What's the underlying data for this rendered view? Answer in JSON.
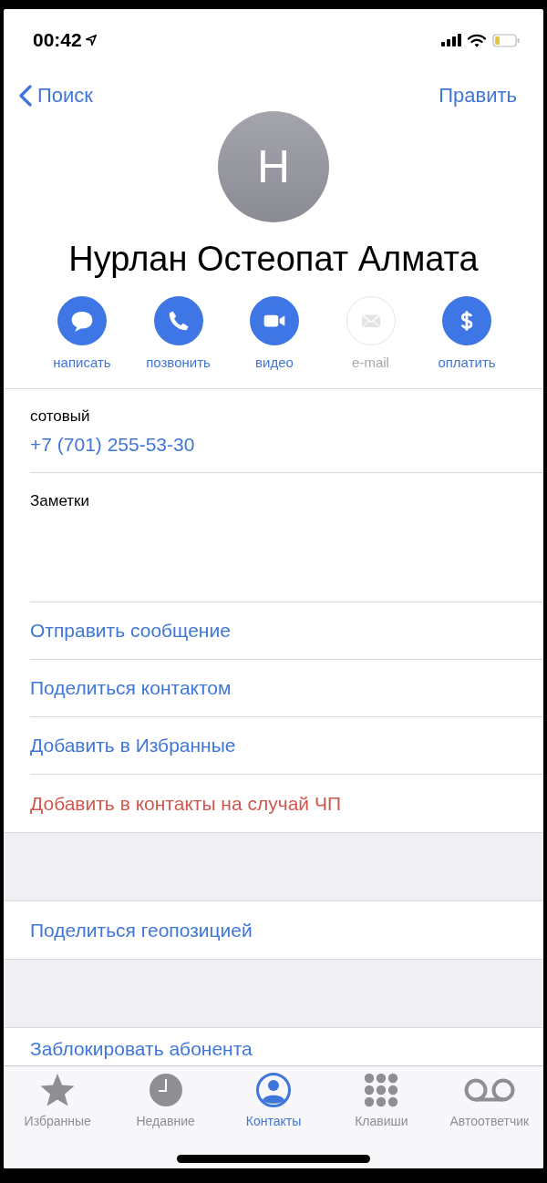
{
  "status_bar": {
    "time": "00:42"
  },
  "nav": {
    "back": "Поиск",
    "edit": "Править"
  },
  "contact": {
    "initial": "Н",
    "name": "Нурлан Остеопат Алмата"
  },
  "actions": [
    {
      "kind": "message",
      "label": "написать",
      "disabled": false
    },
    {
      "kind": "call",
      "label": "позвонить",
      "disabled": false
    },
    {
      "kind": "video",
      "label": "видео",
      "disabled": false
    },
    {
      "kind": "mail",
      "label": "e-mail",
      "disabled": true
    },
    {
      "kind": "pay",
      "label": "оплатить",
      "disabled": false
    }
  ],
  "phone": {
    "label": "сотовый",
    "number": "+7 (701) 255-53-30"
  },
  "notes": {
    "label": "Заметки"
  },
  "sections": [
    [
      {
        "label": "Отправить сообщение",
        "destructive": false
      },
      {
        "label": "Поделиться контактом",
        "destructive": false
      },
      {
        "label": "Добавить в Избранные",
        "destructive": false
      },
      {
        "label": "Добавить в контакты на случай ЧП",
        "destructive": true
      }
    ],
    [
      {
        "label": "Поделиться геопозицией",
        "destructive": false
      }
    ],
    [
      {
        "label": "Заблокировать абонента",
        "destructive": false
      }
    ]
  ],
  "tab_bar": [
    {
      "kind": "star",
      "label": "Избранные",
      "selected": false
    },
    {
      "kind": "clock",
      "label": "Недавние",
      "selected": false
    },
    {
      "kind": "person",
      "label": "Контакты",
      "selected": true
    },
    {
      "kind": "keypad",
      "label": "Клавиши",
      "selected": false
    },
    {
      "kind": "voicemail",
      "label": "Автоответчик",
      "selected": false
    }
  ]
}
